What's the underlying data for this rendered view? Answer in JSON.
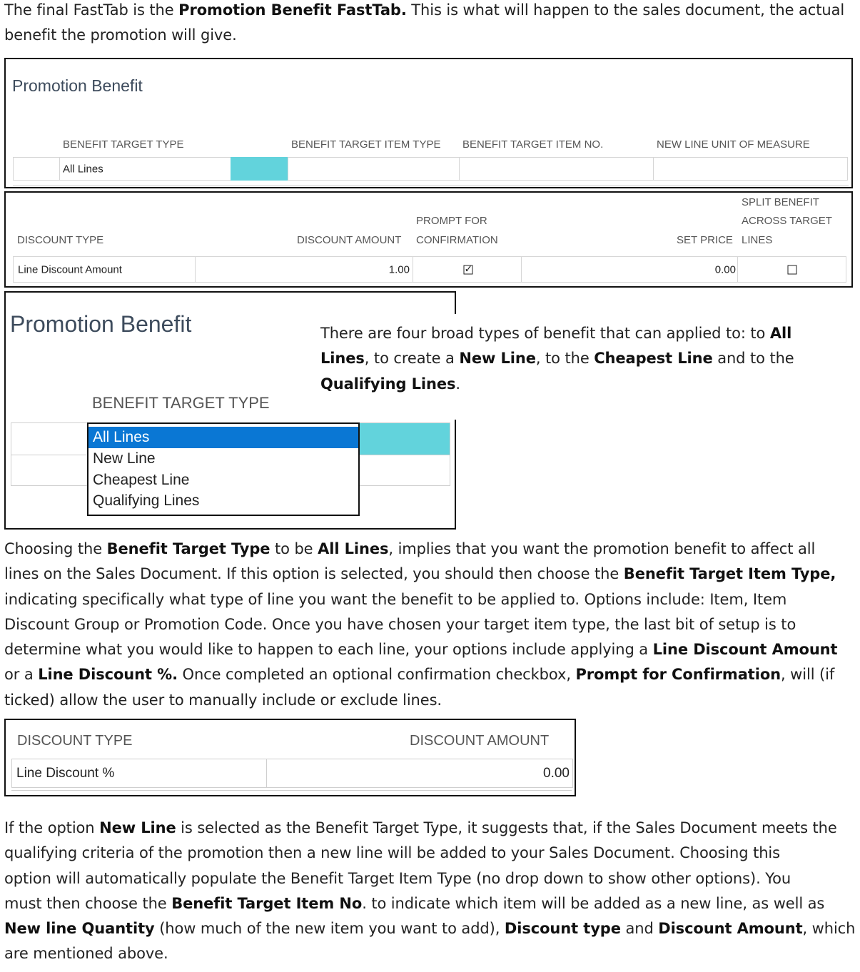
{
  "intro": {
    "t1": "The final FastTab is the ",
    "b1": "Promotion Benefit FastTab.",
    "t2": " This is what will happen to the sales document, the actual",
    "t3": "benefit the promotion will give."
  },
  "panel1": {
    "title": "Promotion Benefit",
    "headers": [
      "BENEFIT TARGET TYPE",
      "BENEFIT TARGET ITEM TYPE",
      "BENEFIT TARGET ITEM NO.",
      "NEW LINE UNIT OF MEASURE"
    ],
    "benefit_target_type": "All Lines"
  },
  "panel2": {
    "headers": {
      "discount_type": "DISCOUNT TYPE",
      "discount_amount": "DISCOUNT AMOUNT",
      "prompt_1": "PROMPT FOR",
      "prompt_2": "CONFIRMATION",
      "set_price": "SET PRICE",
      "split_1": "SPLIT BENEFIT",
      "split_2": "ACROSS TARGET",
      "split_3": "LINES"
    },
    "discount_type": "Line Discount Amount",
    "discount_amount": "1.00",
    "set_price": "0.00",
    "prompt_checked": "✓",
    "split_checked": ""
  },
  "panel3": {
    "title": "Promotion Benefit",
    "header": "BENEFIT TARGET TYPE",
    "options": [
      "All Lines",
      "New Line",
      "Cheapest Line",
      "Qualifying Lines"
    ],
    "selected": "All Lines"
  },
  "callout": {
    "t1": "There are four broad types of benefit that can applied to: to ",
    "b1": "All",
    "b2": "Lines",
    "t2": ", to create a ",
    "b3": "New Line",
    "t3": ", to the ",
    "b4": "Cheapest Line",
    "t4": " and to the",
    "b5": "Qualifying Lines",
    "t5": "."
  },
  "para1": {
    "l1a": "Choosing the ",
    "l1b": "Benefit Target Type",
    "l1c": " to be ",
    "l1d": "All Lines",
    "l1e": ", implies that you want the promotion benefit to affect all",
    "l2a": "lines on the Sales Document. If this option is selected, you should then choose the ",
    "l2b": "Benefit Target Item Type,",
    "l3": "indicating specifically what type of line you want the benefit to be applied to. Options include: Item, Item",
    "l4": "Discount Group or Promotion Code.  Once you have chosen your target item type, the last bit of setup is to",
    "l5a": "determine what you would like to happen to each line, your options include applying a ",
    "l5b": "Line Discount Amount",
    "l6a": "or a ",
    "l6b": "Line Discount %.",
    "l6c": " Once completed an optional confirmation checkbox, ",
    "l6d": "Prompt for Confirmation",
    "l6e": ", will (if",
    "l7": "ticked) allow the user to manually include or exclude lines."
  },
  "panel4": {
    "h1": "DISCOUNT TYPE",
    "h2": "DISCOUNT AMOUNT",
    "discount_type": "Line Discount %",
    "discount_amount": "0.00"
  },
  "para2": {
    "l1a": "If the option ",
    "l1b": "New Line",
    "l1c": " is selected as the Benefit Target Type, it suggests that, if the Sales Document meets the",
    "l2": "qualifying criteria of the promotion then a new line will be added to your Sales Document. Choosing this",
    "l3": "option will automatically populate the Benefit Target Item Type (no drop down to show other options). You",
    "l4a": "must then choose the ",
    "l4b": "Benefit Target Item No",
    "l4c": ". to indicate which item will be added as a new line, as well as",
    "l5a": "New line Quantity",
    "l5b": " (how much of the new item you want to add), ",
    "l5c": "Discount type",
    "l5d": " and ",
    "l5e": "Discount Amount",
    "l5f": ", which",
    "l6": "are mentioned above."
  }
}
